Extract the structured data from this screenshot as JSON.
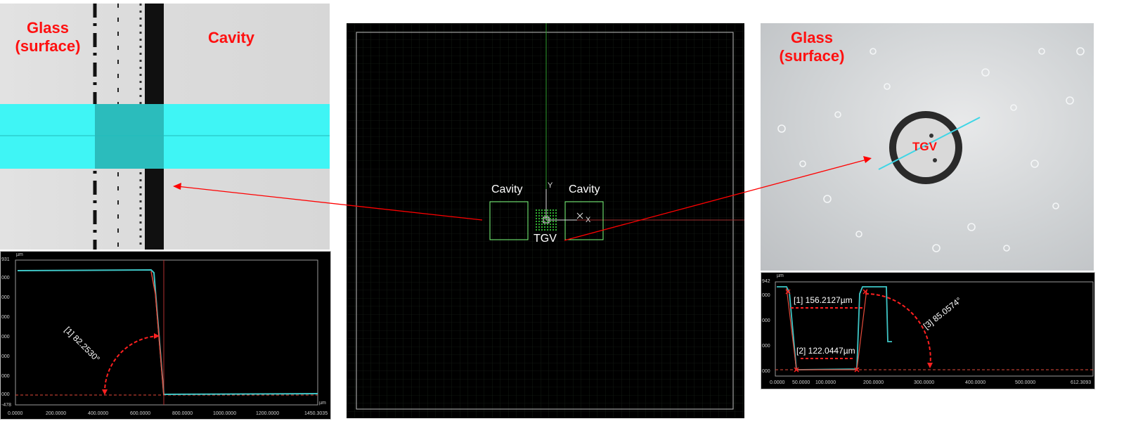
{
  "left_panel": {
    "label_glass_line1": "Glass",
    "label_glass_line2": "(surface)",
    "label_cavity": "Cavity",
    "plot": {
      "unit": "µm",
      "y_top_tick": "931",
      "y_bottom_tick": "-478",
      "y_ticks": [
        "000",
        "000",
        "000",
        "000",
        "000",
        "000",
        "000"
      ],
      "x_ticks": [
        "0.0000",
        "200.0000",
        "400.0000",
        "600.0000",
        "800.0000",
        "1000.0000",
        "1200.0000",
        "1450.3035"
      ],
      "x_unit": "µm",
      "angle_label": "[1] 82.2530°"
    }
  },
  "center_panel": {
    "label_cavity_left": "Cavity",
    "label_cavity_right": "Cavity",
    "label_tgv": "TGV",
    "axis_y": "Y",
    "axis_x": "X"
  },
  "right_panel": {
    "label_glass_line1": "Glass",
    "label_glass_line2": "(surface)",
    "label_tgv": "TGV",
    "plot": {
      "unit": "µm",
      "y_top_tick": "942",
      "y_ticks": [
        "000",
        "000",
        "000",
        "000",
        "000"
      ],
      "x_ticks": [
        "0.0000",
        "50.0000",
        "100.0000",
        "200.0000",
        "300.0000",
        "400.0000",
        "500.0000",
        "612.3093"
      ],
      "measure_1": "[1] 156.2127µm",
      "measure_2": "[2] 122.0447µm",
      "measure_3": "[3] 85.0574°"
    }
  },
  "colors": {
    "label_red": "#ff1010",
    "cyan_band": "#3ff5f5",
    "profile_cyan": "#3fc6c6",
    "profile_red": "#e34a3a",
    "cad_green": "#7dff7d",
    "arrow_red": "#ff0000"
  }
}
